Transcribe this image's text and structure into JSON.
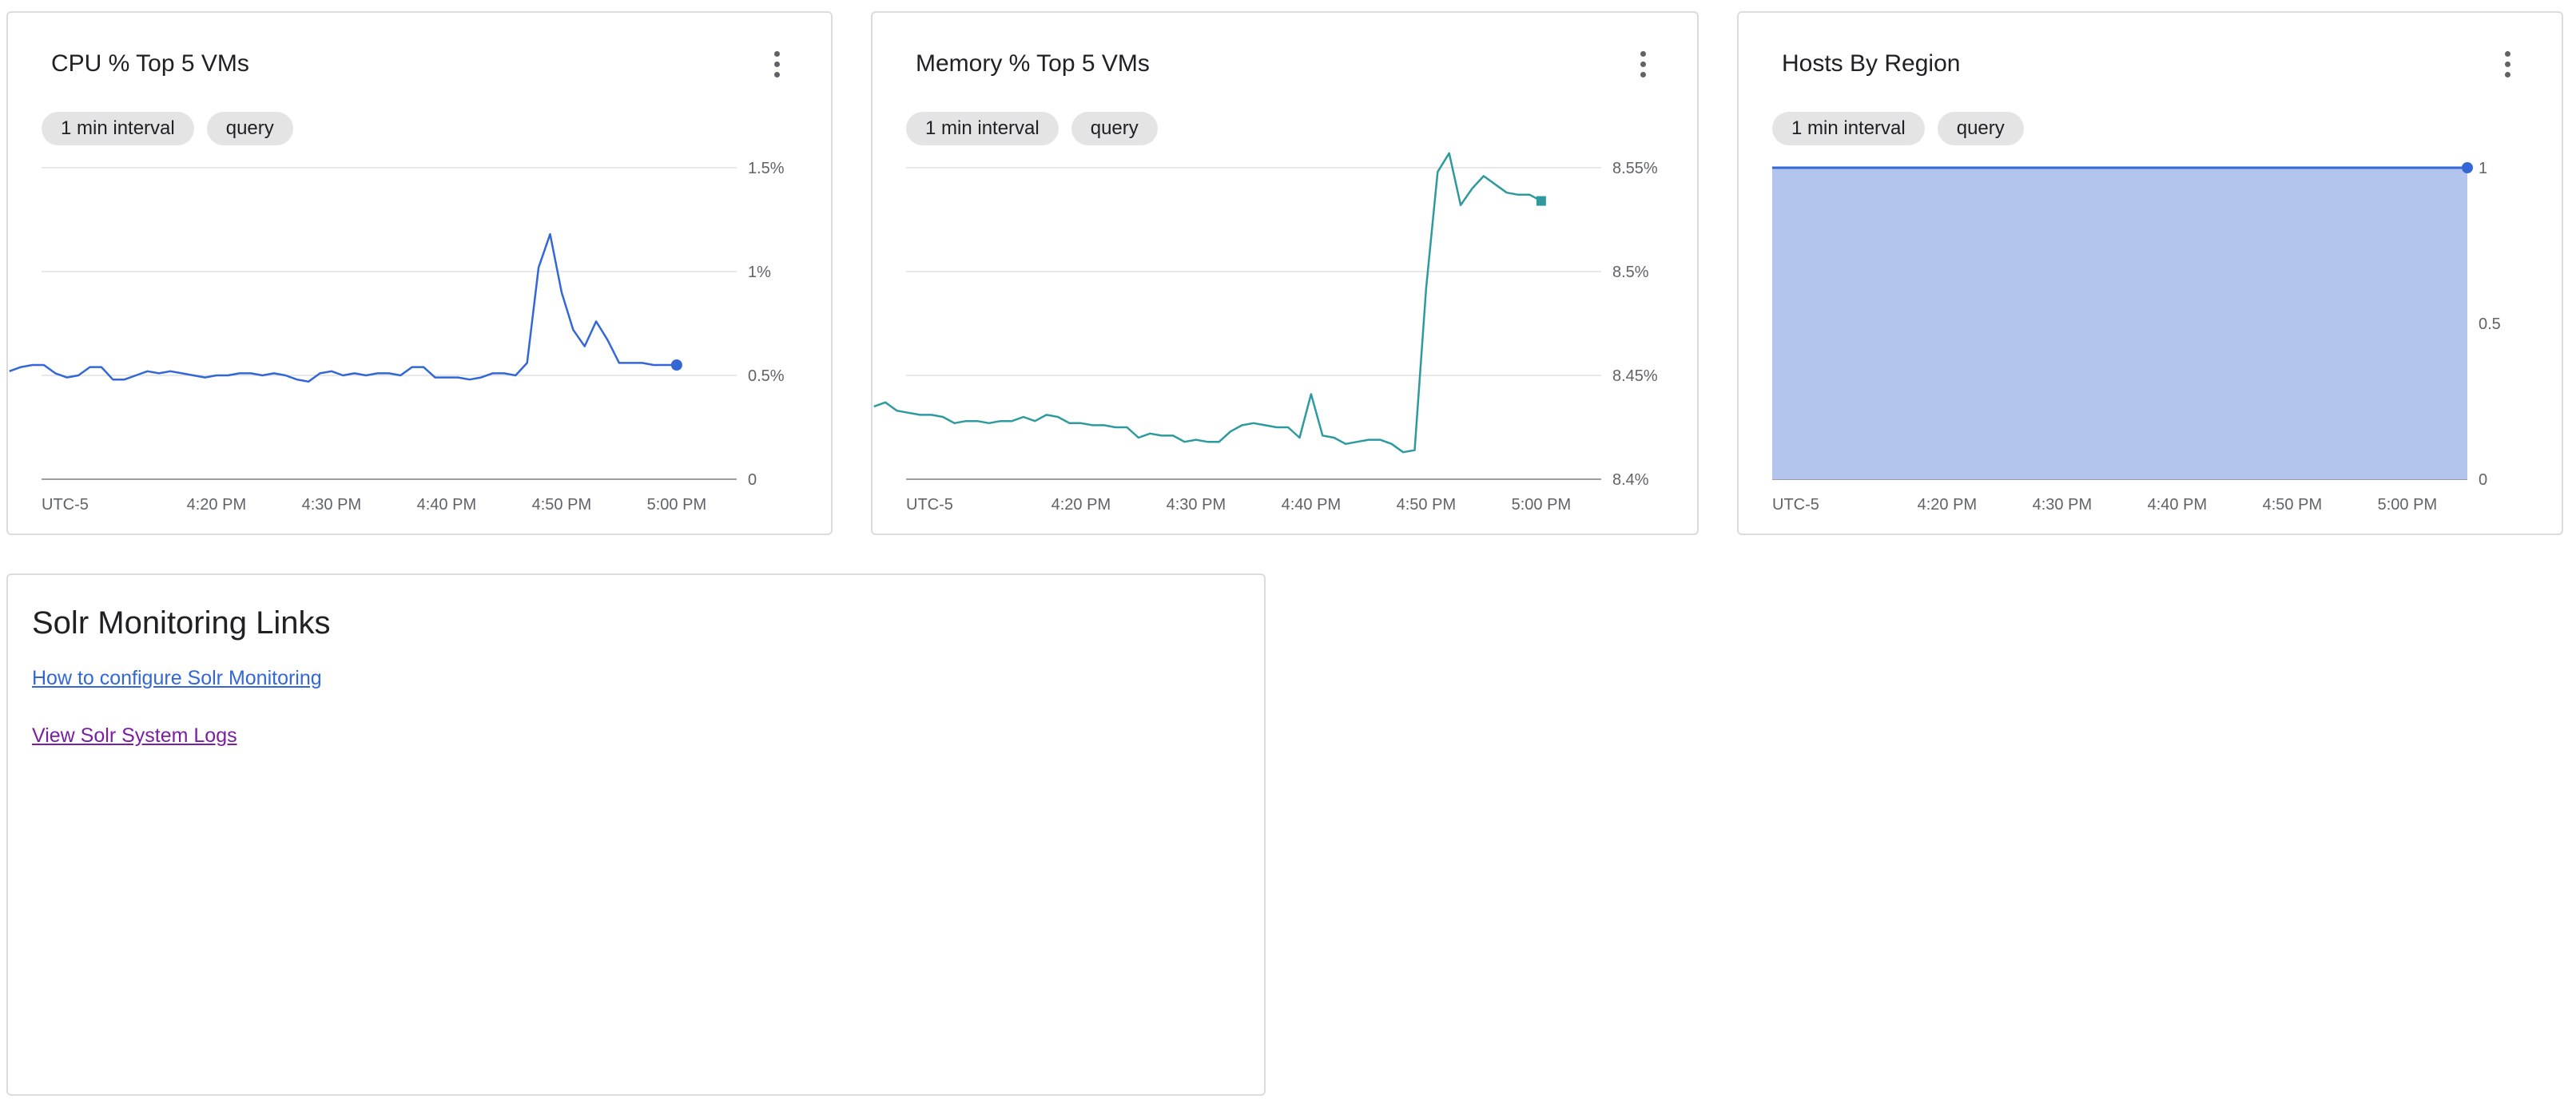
{
  "colors": {
    "cpu_line": "#3367d6",
    "memory_line": "#2e9a9e",
    "hosts_fill": "#b3c5ee",
    "hosts_line": "#3367d6",
    "grid": "#e0e0e0",
    "axis": "#9aa0a6",
    "link": "#3367d6",
    "visited_link": "#7b1fa2"
  },
  "icons": {
    "menu": "more-vert-icon"
  },
  "cards": {
    "cpu": {
      "title": "CPU % Top 5 VMs",
      "chips": [
        "1 min interval",
        "query"
      ]
    },
    "memory": {
      "title": "Memory % Top 5 VMs",
      "chips": [
        "1 min interval",
        "query"
      ]
    },
    "hosts": {
      "title": "Hosts By Region",
      "chips": [
        "1 min interval",
        "query"
      ]
    }
  },
  "links_panel": {
    "title": "Solr Monitoring Links",
    "links": [
      "How to configure Solr Monitoring",
      "View Solr System Logs"
    ]
  },
  "chart_data": [
    {
      "type": "line",
      "title": "CPU % Top 5 VMs",
      "timezone_label": "UTC-5",
      "x_tick_labels": [
        "4:20 PM",
        "4:30 PM",
        "4:40 PM",
        "4:50 PM",
        "5:00 PM"
      ],
      "x_minutes": [
        0,
        1,
        2,
        3,
        4,
        5,
        6,
        7,
        8,
        9,
        10,
        11,
        12,
        13,
        14,
        15,
        16,
        17,
        18,
        19,
        20,
        21,
        22,
        23,
        24,
        25,
        26,
        27,
        28,
        29,
        30,
        31,
        32,
        33,
        34,
        35,
        36,
        37,
        38,
        39,
        40,
        41,
        42,
        43,
        44,
        45,
        46,
        47,
        48,
        49,
        50,
        51,
        52,
        53,
        54,
        55,
        56,
        57,
        58
      ],
      "values": [
        0.52,
        0.54,
        0.55,
        0.55,
        0.51,
        0.49,
        0.5,
        0.54,
        0.54,
        0.48,
        0.48,
        0.5,
        0.52,
        0.51,
        0.52,
        0.51,
        0.5,
        0.49,
        0.5,
        0.5,
        0.51,
        0.51,
        0.5,
        0.51,
        0.5,
        0.48,
        0.47,
        0.51,
        0.52,
        0.5,
        0.51,
        0.5,
        0.51,
        0.51,
        0.5,
        0.54,
        0.54,
        0.49,
        0.49,
        0.49,
        0.48,
        0.49,
        0.51,
        0.51,
        0.5,
        0.56,
        1.02,
        1.18,
        0.9,
        0.72,
        0.64,
        0.76,
        0.67,
        0.56,
        0.56,
        0.56,
        0.55,
        0.55,
        0.55
      ],
      "y_ticks": [
        0,
        0.5,
        1,
        1.5
      ],
      "y_tick_labels": [
        "0",
        "0.5%",
        "1%",
        "1.5%"
      ],
      "ylim": [
        0,
        1.5
      ],
      "grid": true
    },
    {
      "type": "line",
      "title": "Memory % Top 5 VMs",
      "timezone_label": "UTC-5",
      "x_tick_labels": [
        "4:20 PM",
        "4:30 PM",
        "4:40 PM",
        "4:50 PM",
        "5:00 PM"
      ],
      "x_minutes": [
        0,
        1,
        2,
        3,
        4,
        5,
        6,
        7,
        8,
        9,
        10,
        11,
        12,
        13,
        14,
        15,
        16,
        17,
        18,
        19,
        20,
        21,
        22,
        23,
        24,
        25,
        26,
        27,
        28,
        29,
        30,
        31,
        32,
        33,
        34,
        35,
        36,
        37,
        38,
        39,
        40,
        41,
        42,
        43,
        44,
        45,
        46,
        47,
        48,
        49,
        50,
        51,
        52,
        53,
        54,
        55,
        56,
        57,
        58
      ],
      "values": [
        8.435,
        8.437,
        8.433,
        8.432,
        8.431,
        8.431,
        8.43,
        8.427,
        8.428,
        8.428,
        8.427,
        8.428,
        8.428,
        8.43,
        8.428,
        8.431,
        8.43,
        8.427,
        8.427,
        8.426,
        8.426,
        8.425,
        8.425,
        8.42,
        8.422,
        8.421,
        8.421,
        8.418,
        8.419,
        8.418,
        8.418,
        8.423,
        8.426,
        8.427,
        8.426,
        8.425,
        8.425,
        8.42,
        8.441,
        8.421,
        8.42,
        8.417,
        8.418,
        8.419,
        8.419,
        8.417,
        8.413,
        8.414,
        8.492,
        8.548,
        8.557,
        8.532,
        8.54,
        8.546,
        8.542,
        8.538,
        8.537,
        8.537,
        8.534
      ],
      "y_ticks": [
        8.4,
        8.45,
        8.5,
        8.55
      ],
      "y_tick_labels": [
        "8.4%",
        "8.45%",
        "8.5%",
        "8.55%"
      ],
      "ylim": [
        8.4,
        8.55
      ],
      "grid": true
    },
    {
      "type": "area",
      "title": "Hosts By Region",
      "timezone_label": "UTC-5",
      "x_tick_labels": [
        "4:20 PM",
        "4:30 PM",
        "4:40 PM",
        "4:50 PM",
        "5:00 PM"
      ],
      "x_minutes": [
        0,
        58
      ],
      "values": [
        1,
        1
      ],
      "y_ticks": [
        0,
        0.5,
        1
      ],
      "y_tick_labels": [
        "0",
        "0.5",
        "1"
      ],
      "ylim": [
        0,
        1
      ],
      "grid": true
    }
  ]
}
